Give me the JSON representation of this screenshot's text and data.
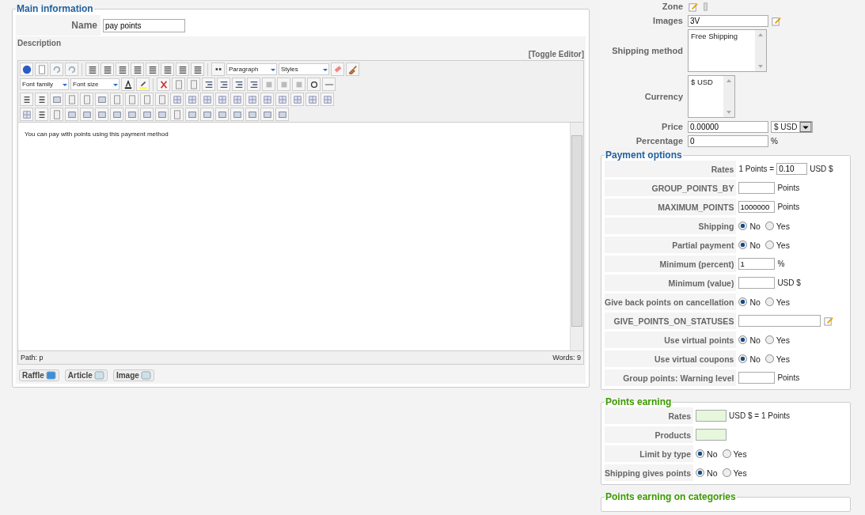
{
  "main_information": {
    "title": "Main information",
    "name": {
      "label": "Name",
      "value": "pay points"
    },
    "description": {
      "label": "Description",
      "toggle": "[Toggle Editor]",
      "toolbar": {
        "format": "Paragraph",
        "styles": "Styles",
        "font_family": "Font family",
        "font_size": "Font size"
      },
      "content": "You can pay with points using this payment method",
      "path": "Path: p",
      "words": "Words: 9"
    },
    "buttons": [
      "Raffle",
      "Article",
      "Image"
    ]
  },
  "top_fields": [
    {
      "kind": "icons",
      "label": "Zone"
    },
    {
      "kind": "text_icon",
      "label": "Images",
      "value": "3V"
    },
    {
      "kind": "listbox",
      "label": "Shipping method",
      "options": [
        "Free Shipping"
      ],
      "wide": true
    },
    {
      "kind": "listbox",
      "label": "Currency",
      "options": [
        "$ USD"
      ],
      "wide": false
    },
    {
      "kind": "price",
      "label": "Price",
      "value": "0.00000",
      "currency": "$ USD"
    },
    {
      "kind": "text",
      "label": "Percentage",
      "value": "0",
      "suffix": "%"
    }
  ],
  "sections": [
    {
      "title": "Payment options",
      "color": "#1f5f9e",
      "rows": [
        {
          "kind": "rate",
          "label": "Rates",
          "prefix": "1 Points =",
          "value": "0.10",
          "suffix": "USD $"
        },
        {
          "kind": "input",
          "label": "GROUP_POINTS_BY",
          "value": "",
          "suffix": "Points"
        },
        {
          "kind": "input",
          "label": "MAXIMUM_POINTS",
          "value": "1000000",
          "suffix": "Points"
        },
        {
          "kind": "radio",
          "label": "Shipping",
          "options": [
            {
              "label": "No",
              "selected": true
            },
            {
              "label": "Yes",
              "selected": false
            }
          ]
        },
        {
          "kind": "radio",
          "label": "Partial payment",
          "options": [
            {
              "label": "No",
              "selected": true
            },
            {
              "label": "Yes",
              "selected": false
            }
          ]
        },
        {
          "kind": "input",
          "label": "Minimum (percent)",
          "value": "1",
          "suffix": "%"
        },
        {
          "kind": "input",
          "label": "Minimum (value)",
          "value": "",
          "suffix": "USD $"
        },
        {
          "kind": "radio",
          "label": "Give back points on cancellation",
          "options": [
            {
              "label": "No",
              "selected": true
            },
            {
              "label": "Yes",
              "selected": false
            }
          ]
        },
        {
          "kind": "wide_input",
          "label": "GIVE_POINTS_ON_STATUSES",
          "value": ""
        },
        {
          "kind": "radio",
          "label": "Use virtual points",
          "options": [
            {
              "label": "No",
              "selected": true
            },
            {
              "label": "Yes",
              "selected": false
            }
          ]
        },
        {
          "kind": "radio",
          "label": "Use virtual coupons",
          "options": [
            {
              "label": "No",
              "selected": true
            },
            {
              "label": "Yes",
              "selected": false
            }
          ]
        },
        {
          "kind": "input",
          "label": "Group points: Warning level",
          "value": "",
          "suffix": "Points"
        }
      ]
    },
    {
      "title": "Points earning",
      "color": "#3d9a00",
      "rows": [
        {
          "kind": "green_input",
          "label": "Rates",
          "value": "",
          "suffix": "USD $ = 1 Points"
        },
        {
          "kind": "green_input",
          "label": "Products",
          "value": ""
        },
        {
          "kind": "radio",
          "label": "Limit by type",
          "options": [
            {
              "label": "No",
              "selected": true
            },
            {
              "label": "Yes",
              "selected": false
            }
          ]
        },
        {
          "kind": "radio",
          "label": "Shipping gives points",
          "options": [
            {
              "label": "No",
              "selected": true
            },
            {
              "label": "Yes",
              "selected": false
            }
          ]
        }
      ]
    },
    {
      "title": "Points earning on categories",
      "color": "#3d9a00"
    }
  ]
}
